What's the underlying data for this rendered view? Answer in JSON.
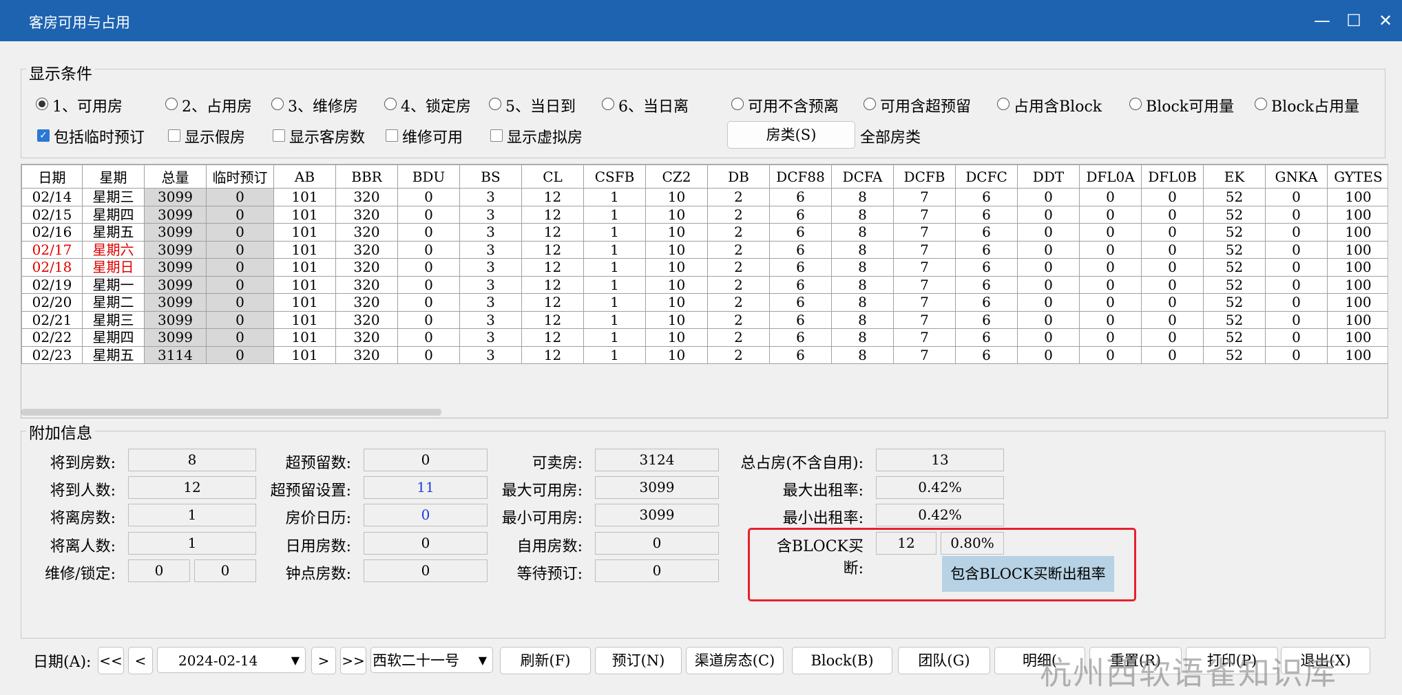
{
  "window": {
    "title": "客房可用与占用"
  },
  "conditions": {
    "legend": "显示条件",
    "radios": [
      {
        "label": "1、可用房",
        "checked": true
      },
      {
        "label": "2、占用房",
        "checked": false
      },
      {
        "label": "3、维修房",
        "checked": false
      },
      {
        "label": "4、锁定房",
        "checked": false
      },
      {
        "label": "5、当日到",
        "checked": false
      },
      {
        "label": "6、当日离",
        "checked": false
      },
      {
        "label": "可用不含预离",
        "checked": false
      },
      {
        "label": "可用含超预留",
        "checked": false
      },
      {
        "label": "占用含Block",
        "checked": false
      },
      {
        "label": "Block可用量",
        "checked": false
      },
      {
        "label": "Block占用量",
        "checked": false
      }
    ],
    "checkboxes": [
      {
        "label": "包括临时预订",
        "checked": true
      },
      {
        "label": "显示假房",
        "checked": false
      },
      {
        "label": "显示客房数",
        "checked": false
      },
      {
        "label": "维修可用",
        "checked": false
      },
      {
        "label": "显示虚拟房",
        "checked": false
      }
    ],
    "room_type_button": "房类(S)",
    "room_type_value": "全部房类"
  },
  "table": {
    "columns": [
      "日期",
      "星期",
      "总量",
      "临时预订",
      "AB",
      "BBR",
      "BDU",
      "BS",
      "CL",
      "CSFB",
      "CZ2",
      "DB",
      "DCF88",
      "DCFA",
      "DCFB",
      "DCFC",
      "DDT",
      "DFL0A",
      "DFL0B",
      "EK",
      "GNKA",
      "GYTES"
    ],
    "rows": [
      {
        "cells": [
          "02/14",
          "星期三",
          "3099",
          "0",
          "101",
          "320",
          "0",
          "3",
          "12",
          "1",
          "10",
          "2",
          "6",
          "8",
          "7",
          "6",
          "0",
          "0",
          "0",
          "52",
          "0",
          "100"
        ],
        "weekend": false
      },
      {
        "cells": [
          "02/15",
          "星期四",
          "3099",
          "0",
          "101",
          "320",
          "0",
          "3",
          "12",
          "1",
          "10",
          "2",
          "6",
          "8",
          "7",
          "6",
          "0",
          "0",
          "0",
          "52",
          "0",
          "100"
        ],
        "weekend": false
      },
      {
        "cells": [
          "02/16",
          "星期五",
          "3099",
          "0",
          "101",
          "320",
          "0",
          "3",
          "12",
          "1",
          "10",
          "2",
          "6",
          "8",
          "7",
          "6",
          "0",
          "0",
          "0",
          "52",
          "0",
          "100"
        ],
        "weekend": false
      },
      {
        "cells": [
          "02/17",
          "星期六",
          "3099",
          "0",
          "101",
          "320",
          "0",
          "3",
          "12",
          "1",
          "10",
          "2",
          "6",
          "8",
          "7",
          "6",
          "0",
          "0",
          "0",
          "52",
          "0",
          "100"
        ],
        "weekend": true
      },
      {
        "cells": [
          "02/18",
          "星期日",
          "3099",
          "0",
          "101",
          "320",
          "0",
          "3",
          "12",
          "1",
          "10",
          "2",
          "6",
          "8",
          "7",
          "6",
          "0",
          "0",
          "0",
          "52",
          "0",
          "100"
        ],
        "weekend": true
      },
      {
        "cells": [
          "02/19",
          "星期一",
          "3099",
          "0",
          "101",
          "320",
          "0",
          "3",
          "12",
          "1",
          "10",
          "2",
          "6",
          "8",
          "7",
          "6",
          "0",
          "0",
          "0",
          "52",
          "0",
          "100"
        ],
        "weekend": false
      },
      {
        "cells": [
          "02/20",
          "星期二",
          "3099",
          "0",
          "101",
          "320",
          "0",
          "3",
          "12",
          "1",
          "10",
          "2",
          "6",
          "8",
          "7",
          "6",
          "0",
          "0",
          "0",
          "52",
          "0",
          "100"
        ],
        "weekend": false
      },
      {
        "cells": [
          "02/21",
          "星期三",
          "3099",
          "0",
          "101",
          "320",
          "0",
          "3",
          "12",
          "1",
          "10",
          "2",
          "6",
          "8",
          "7",
          "6",
          "0",
          "0",
          "0",
          "52",
          "0",
          "100"
        ],
        "weekend": false
      },
      {
        "cells": [
          "02/22",
          "星期四",
          "3099",
          "0",
          "101",
          "320",
          "0",
          "3",
          "12",
          "1",
          "10",
          "2",
          "6",
          "8",
          "7",
          "6",
          "0",
          "0",
          "0",
          "52",
          "0",
          "100"
        ],
        "weekend": false
      },
      {
        "cells": [
          "02/23",
          "星期五",
          "3114",
          "0",
          "101",
          "320",
          "0",
          "3",
          "12",
          "1",
          "10",
          "2",
          "6",
          "8",
          "7",
          "6",
          "0",
          "0",
          "0",
          "52",
          "0",
          "100"
        ],
        "weekend": false
      }
    ]
  },
  "extra": {
    "legend": "附加信息",
    "arrive_rooms_label": "将到房数:",
    "arrive_rooms": "8",
    "arrive_people_label": "将到人数:",
    "arrive_people": "12",
    "depart_rooms_label": "将离房数:",
    "depart_rooms": "1",
    "depart_people_label": "将离人数:",
    "depart_people": "1",
    "maint_lock_label": "维修/锁定:",
    "maint": "0",
    "lock": "0",
    "overbook_count_label": "超预留数:",
    "overbook_count": "0",
    "overbook_setting_label": "超预留设置:",
    "overbook_setting": "11",
    "rate_calendar_label": "房价日历:",
    "rate_calendar": "0",
    "day_use_label": "日用房数:",
    "day_use": "0",
    "hourly_label": "钟点房数:",
    "hourly": "0",
    "sellable_label": "可卖房:",
    "sellable": "3124",
    "max_avail_label": "最大可用房:",
    "max_avail": "3099",
    "min_avail_label": "最小可用房:",
    "min_avail": "3099",
    "self_use_label": "自用房数:",
    "self_use": "0",
    "waitlist_label": "等待预订:",
    "waitlist": "0",
    "total_occ_label": "总占房(不含自用):",
    "total_occ": "13",
    "max_occ_label": "最大出租率:",
    "max_occ": "0.42%",
    "min_occ_label": "最小出租率:",
    "min_occ": "0.42%",
    "block_label": "含BLOCK买断:",
    "block_rooms": "12",
    "block_rate": "0.80%",
    "block_tooltip": "包含BLOCK买断出租率",
    "highlight_color": "#e8202a"
  },
  "footer": {
    "date_label": "日期(A):",
    "first": "<<",
    "prev": "<",
    "date": "2024-02-14",
    "next": ">",
    "last": ">>",
    "hotel": "西软二十一号",
    "refresh": "刷新(F)",
    "reserve": "预订(N)",
    "channel": "渠道房态(C)",
    "block": "Block(B)",
    "group": "团队(G)",
    "detail": "明细(",
    "reset": "重置(R)",
    "print": "打印(P)",
    "exit": "退出(X)"
  },
  "watermark": "杭州西软语雀知识库"
}
